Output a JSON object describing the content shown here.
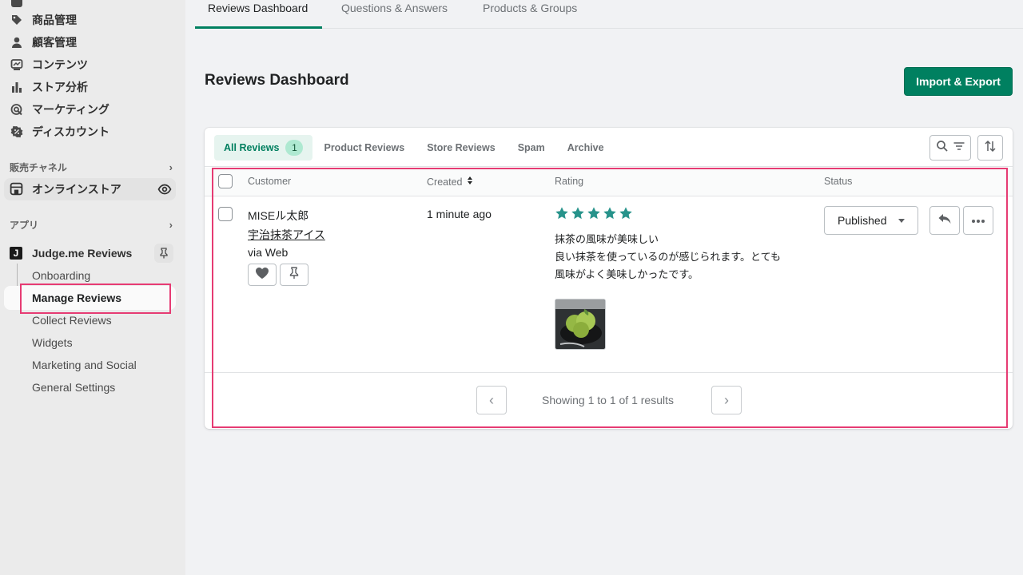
{
  "sidebar": {
    "nav": [
      {
        "label": "商品管理",
        "icon": "tag-icon"
      },
      {
        "label": "顧客管理",
        "icon": "person-icon"
      },
      {
        "label": "コンテンツ",
        "icon": "content-icon"
      },
      {
        "label": "ストア分析",
        "icon": "bar-chart-icon"
      },
      {
        "label": "マーケティング",
        "icon": "target-icon"
      },
      {
        "label": "ディスカウント",
        "icon": "discount-icon"
      }
    ],
    "sales_channels_label": "販売チャネル",
    "online_store_label": "オンラインストア",
    "apps_label": "アプリ",
    "app_name": "Judge.me Reviews",
    "app_logo_letter": "J",
    "sub_items": [
      "Onboarding",
      "Manage Reviews",
      "Collect Reviews",
      "Widgets",
      "Marketing and Social",
      "General Settings"
    ]
  },
  "top_tabs": [
    "Reviews Dashboard",
    "Questions & Answers",
    "Products & Groups"
  ],
  "page": {
    "title": "Reviews Dashboard",
    "import_export_label": "Import & Export"
  },
  "filters": {
    "tabs": [
      "All Reviews",
      "Product Reviews",
      "Store Reviews",
      "Spam",
      "Archive"
    ],
    "all_count": "1"
  },
  "table": {
    "columns": {
      "customer": "Customer",
      "created": "Created",
      "rating": "Rating",
      "status": "Status"
    },
    "rows": [
      {
        "customer": "MISEル太郎",
        "product": "宇治抹茶アイス",
        "source": "via Web",
        "created": "1 minute ago",
        "rating": 5,
        "review_title": "抹茶の風味が美味しい",
        "review_body": "良い抹茶を使っているのが感じられます。とても風味がよく美味しかったです。",
        "status": "Published"
      }
    ]
  },
  "pagination": {
    "info": "Showing 1 to 1 of 1 results"
  },
  "colors": {
    "primary": "#008060",
    "star": "#27938b",
    "highlight": "#e63b73"
  }
}
